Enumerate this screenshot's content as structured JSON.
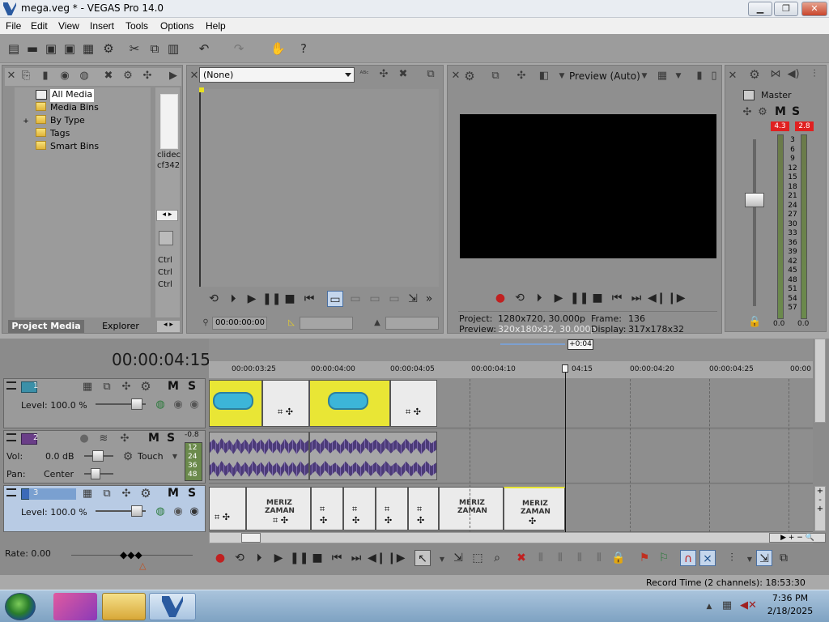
{
  "window": {
    "title": "mega.veg * - VEGAS Pro 14.0",
    "btn_min": "▁",
    "btn_max": "❐",
    "btn_close": "✕"
  },
  "menu": [
    "File",
    "Edit",
    "View",
    "Insert",
    "Tools",
    "Options",
    "Help"
  ],
  "project_media": {
    "tree": [
      "All Media",
      "Media Bins",
      "By Type",
      "Tags",
      "Smart Bins"
    ],
    "expand_marker": "+",
    "media_name_1": "clidec",
    "media_name_2": "cf342",
    "shortcuts": [
      "Ctrl",
      "Ctrl",
      "Ctrl"
    ],
    "tabs": [
      "Project Media",
      "Explorer"
    ]
  },
  "trimmer": {
    "dropdown_value": "(None)",
    "timecode": "00:00:00:00"
  },
  "preview": {
    "mode": "Preview (Auto)",
    "project_label": "Project:",
    "project_value": "1280x720, 30.000p",
    "preview_label": "Preview:",
    "preview_value": "320x180x32, 30.000p",
    "frame_label": "Frame:",
    "frame_value": "136",
    "display_label": "Display:",
    "display_value": "317x178x32"
  },
  "master_bus": {
    "label": "Master",
    "peak_left": "4.3",
    "peak_right": "2.8",
    "scale": [
      "3",
      "6",
      "9",
      "12",
      "15",
      "18",
      "21",
      "24",
      "27",
      "30",
      "33",
      "36",
      "39",
      "42",
      "45",
      "48",
      "51",
      "54",
      "57"
    ],
    "bottom_left": "0.0",
    "bottom_right": "0.0"
  },
  "timeline": {
    "cursor_time": "00:00:04:15",
    "offset_badge": "+0:04",
    "ruler": [
      "00:00:03:25",
      "00:00:04:00",
      "00:00:04:05",
      "00:00:04:10",
      "04:15",
      "00:00:04:20",
      "00:00:04:25",
      "00:00"
    ],
    "rate_label": "Rate: 0.00",
    "status": "Record Time (2 channels): 18:53:30"
  },
  "tracks": [
    {
      "num": "1",
      "level_label": "Level: 100.0 %"
    },
    {
      "num": "2",
      "vol_label": "Vol:",
      "vol_value": "0.0 dB",
      "pan_label": "Pan:",
      "pan_value": "Center",
      "mode": "Touch",
      "meter_top": "-0.8",
      "meter_scale": [
        "12",
        "24",
        "36",
        "48"
      ]
    },
    {
      "num": "3",
      "level_label": "Level: 100.0 %"
    }
  ],
  "clip_text": "MERIZ ZAMAN",
  "taskbar": {
    "time": "7:36 PM",
    "date": "2/18/2025"
  },
  "colors": {
    "accent": "#2a5aa0",
    "track_selected": "#b8cbe4",
    "peak_red": "#e02020",
    "clip_yellow": "#e9e635"
  }
}
